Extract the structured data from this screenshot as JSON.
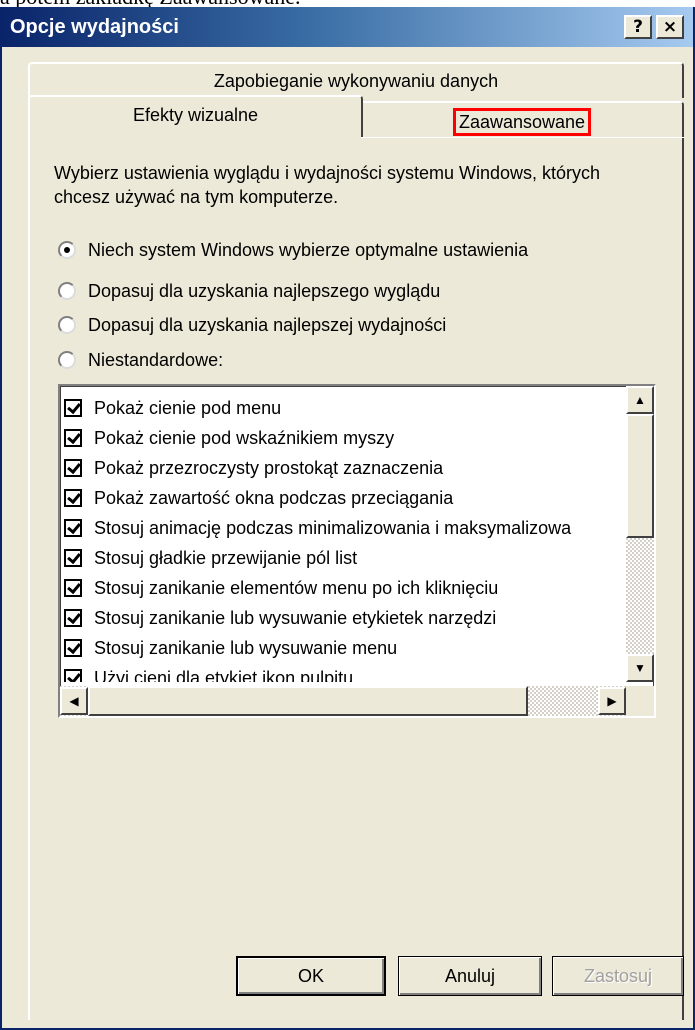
{
  "caption": "a potem zakładkę Zaawansowane.",
  "window": {
    "title": "Opcje wydajności",
    "help_btn": "?",
    "close_btn": "×"
  },
  "tabs": {
    "dep": "Zapobieganie wykonywaniu danych",
    "visual": "Efekty wizualne",
    "advanced": "Zaawansowane",
    "highlight_color": "#ff0000"
  },
  "description": "Wybierz ustawienia wyglądu i wydajności systemu Windows, których chcesz używać na tym komputerze.",
  "radio_options": [
    {
      "label": "Niech system Windows wybierze optymalne ustawienia",
      "selected": true
    },
    {
      "label": "Dopasuj dla uzyskania najlepszego wyglądu",
      "selected": false
    },
    {
      "label": "Dopasuj dla uzyskania najlepszej wydajności",
      "selected": false
    },
    {
      "label": "Niestandardowe:",
      "selected": false
    }
  ],
  "effects": [
    {
      "label": "Pokaż cienie pod menu",
      "checked": true
    },
    {
      "label": "Pokaż cienie pod wskaźnikiem myszy",
      "checked": true
    },
    {
      "label": "Pokaż przezroczysty prostokąt zaznaczenia",
      "checked": true
    },
    {
      "label": "Pokaż zawartość okna podczas przeciągania",
      "checked": true
    },
    {
      "label": "Stosuj animację podczas minimalizowania i maksymalizowa",
      "checked": true
    },
    {
      "label": "Stosuj gładkie przewijanie pól list",
      "checked": true
    },
    {
      "label": "Stosuj zanikanie elementów menu po ich kliknięciu",
      "checked": true
    },
    {
      "label": "Stosuj zanikanie lub wysuwanie etykietek narzędzi",
      "checked": true
    },
    {
      "label": "Stosuj zanikanie lub wysuwanie menu",
      "checked": true
    },
    {
      "label": "Użyj cieni dla etykiet ikon pulpitu",
      "checked": true
    }
  ],
  "scroll": {
    "up": "▲",
    "down": "▼",
    "left": "◀",
    "right": "▶"
  },
  "buttons": {
    "ok": "OK",
    "cancel": "Anuluj",
    "apply": "Zastosuj"
  }
}
